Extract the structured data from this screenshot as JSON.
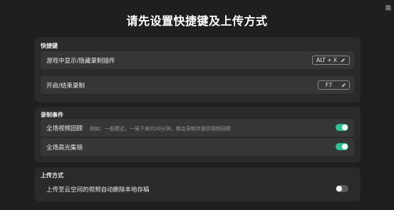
{
  "window": {
    "title": "请先设置快捷键及上传方式",
    "corner_label": "跳"
  },
  "sections": {
    "hotkeys": {
      "title": "快捷键",
      "toggle_plugin": {
        "label": "游戏中显示/隐藏录制插件",
        "hotkey": "ALT + X"
      },
      "toggle_recording": {
        "label": "开启/结束录制",
        "hotkey": "F7"
      }
    },
    "recording_events": {
      "title": "录制事件",
      "full_replay": {
        "label": "全场视频回顾",
        "hint": "例如：一般模式，一局下来约30分钟，都会录制并提供视频回顾",
        "enabled": true
      },
      "highlights": {
        "label": "全场高光集锦",
        "enabled": true
      }
    },
    "upload": {
      "title": "上传方式",
      "auto_delete": {
        "label": "上传至云空间的视频自动删除本地存稿",
        "enabled": false
      }
    }
  },
  "colors": {
    "accent": "#2fc296",
    "background": "#1f1f1f",
    "card": "#2a2a2a",
    "row": "#363636"
  },
  "icons": {
    "edit": "pencil-icon"
  }
}
